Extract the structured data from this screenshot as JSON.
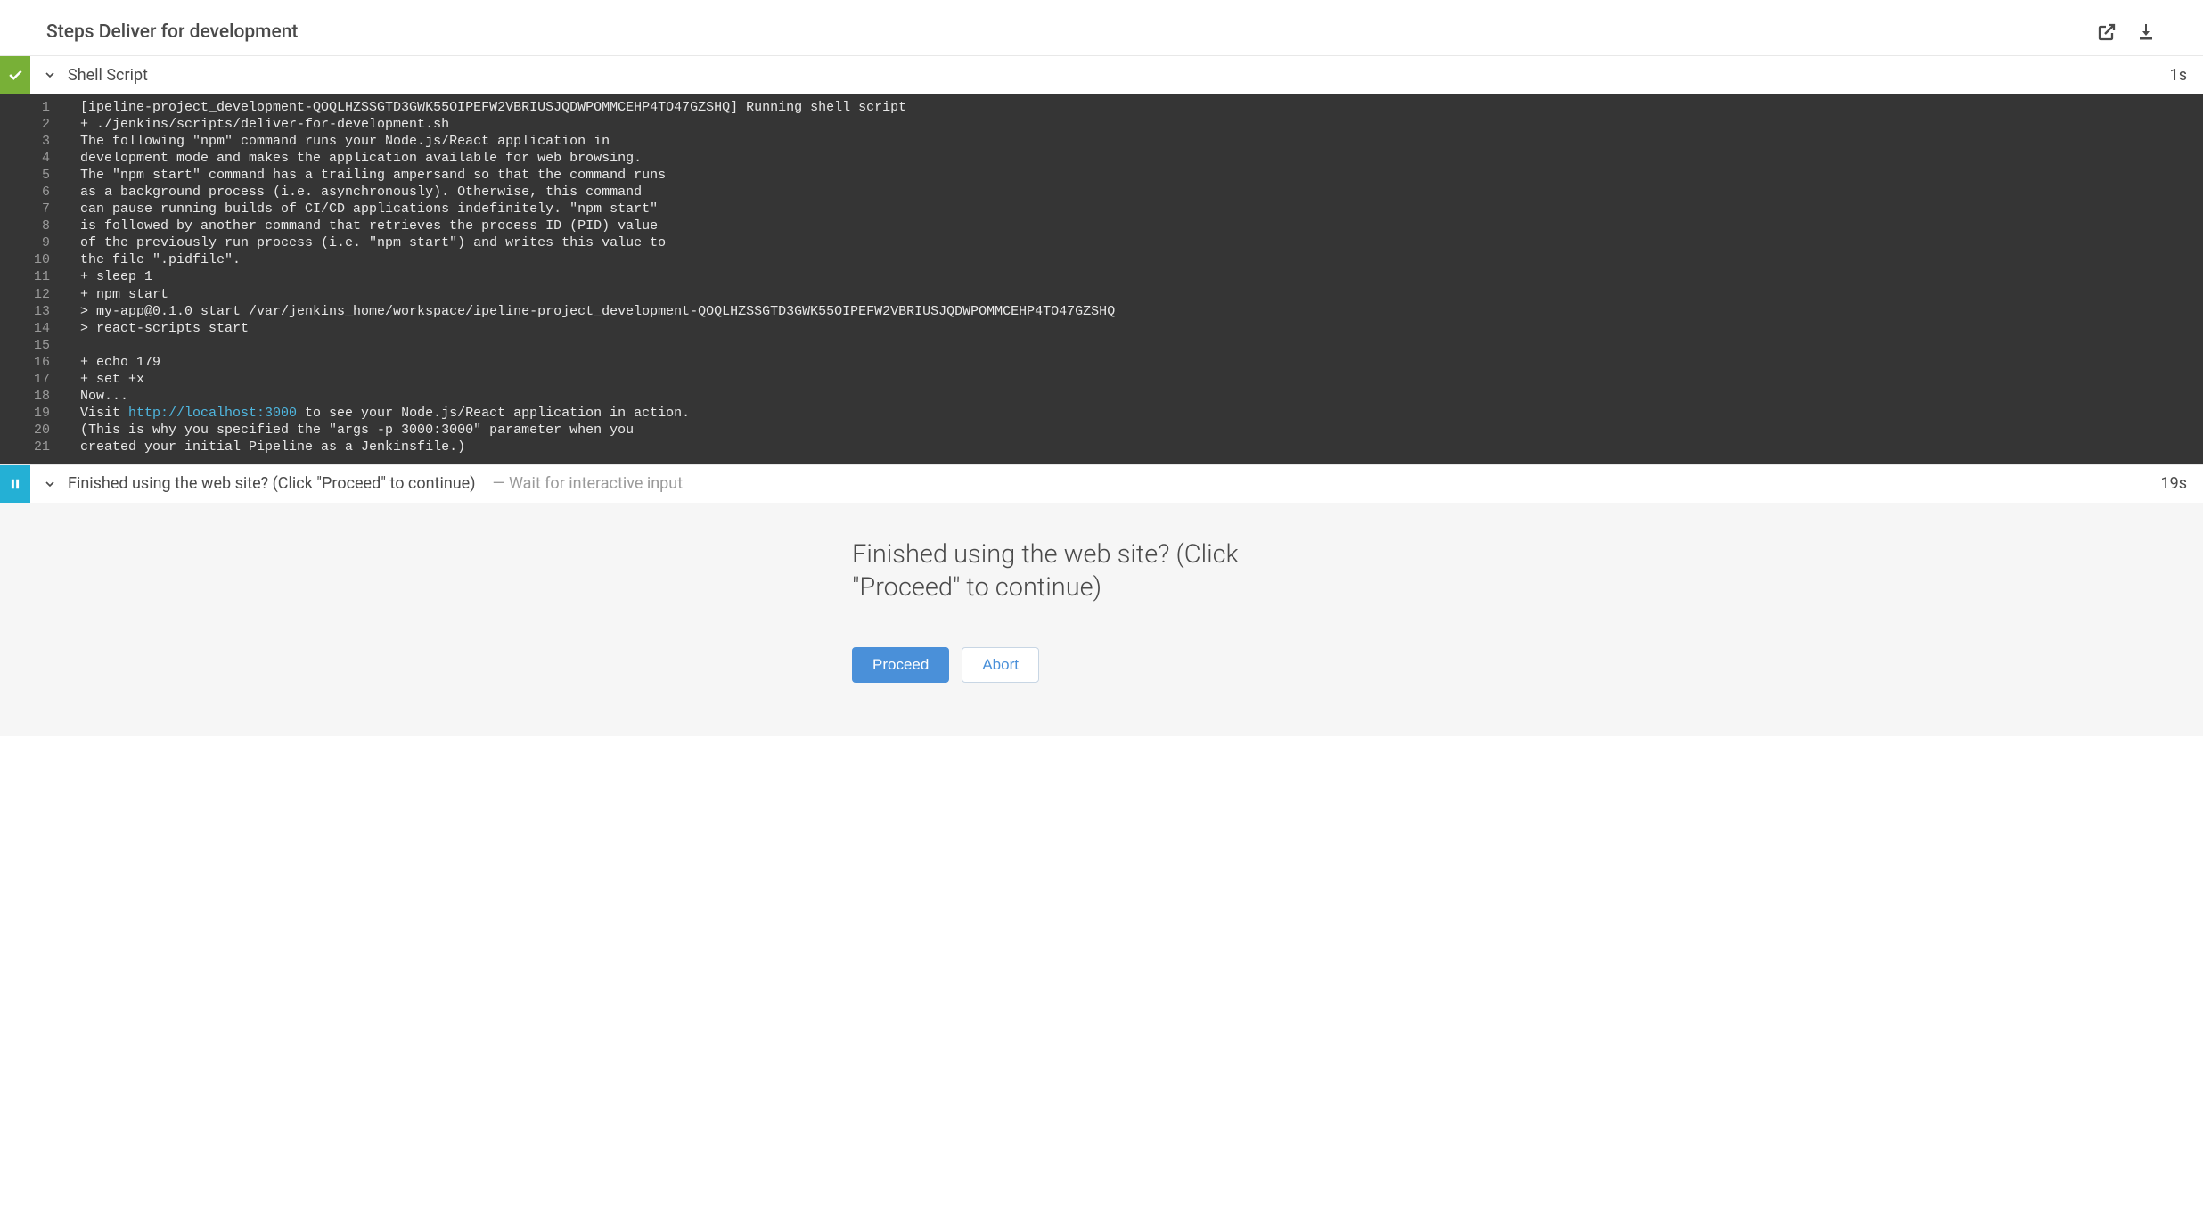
{
  "header": {
    "title_prefix": "Steps ",
    "title_stage": "Deliver for development"
  },
  "steps": [
    {
      "status": "success",
      "title": "Shell Script",
      "duration": "1s",
      "log": [
        {
          "n": 1,
          "t": "[ipeline-project_development-QOQLHZSSGTD3GWK55OIPEFW2VBRIUSJQDWPOMMCEHP4TO47GZSHQ] Running shell script"
        },
        {
          "n": 2,
          "t": "+ ./jenkins/scripts/deliver-for-development.sh"
        },
        {
          "n": 3,
          "t": "The following \"npm\" command runs your Node.js/React application in"
        },
        {
          "n": 4,
          "t": "development mode and makes the application available for web browsing."
        },
        {
          "n": 5,
          "t": "The \"npm start\" command has a trailing ampersand so that the command runs"
        },
        {
          "n": 6,
          "t": "as a background process (i.e. asynchronously). Otherwise, this command"
        },
        {
          "n": 7,
          "t": "can pause running builds of CI/CD applications indefinitely. \"npm start\""
        },
        {
          "n": 8,
          "t": "is followed by another command that retrieves the process ID (PID) value"
        },
        {
          "n": 9,
          "t": "of the previously run process (i.e. \"npm start\") and writes this value to"
        },
        {
          "n": 10,
          "t": "the file \".pidfile\"."
        },
        {
          "n": 11,
          "t": "+ sleep 1"
        },
        {
          "n": 12,
          "t": "+ npm start"
        },
        {
          "n": 13,
          "t": "> my-app@0.1.0 start /var/jenkins_home/workspace/ipeline-project_development-QOQLHZSSGTD3GWK55OIPEFW2VBRIUSJQDWPOMMCEHP4TO47GZSHQ"
        },
        {
          "n": 14,
          "t": "> react-scripts start"
        },
        {
          "n": 15,
          "t": ""
        },
        {
          "n": 16,
          "t": "+ echo 179"
        },
        {
          "n": 17,
          "t": "+ set +x"
        },
        {
          "n": 18,
          "t": "Now..."
        },
        {
          "n": 19,
          "t_before": "Visit ",
          "link": "http://localhost:3000",
          "t_after": " to see your Node.js/React application in action."
        },
        {
          "n": 20,
          "t": "(This is why you specified the \"args -p 3000:3000\" parameter when you"
        },
        {
          "n": 21,
          "t": "created your initial Pipeline as a Jenkinsfile.)"
        }
      ]
    },
    {
      "status": "paused",
      "title": "Finished using the web site? (Click \"Proceed\" to continue)",
      "subtitle_sep": "— ",
      "subtitle": "Wait for interactive input",
      "duration": "19s",
      "input": {
        "message": "Finished using the web site? (Click \"Proceed\" to continue)",
        "proceed_label": "Proceed",
        "abort_label": "Abort"
      }
    }
  ]
}
